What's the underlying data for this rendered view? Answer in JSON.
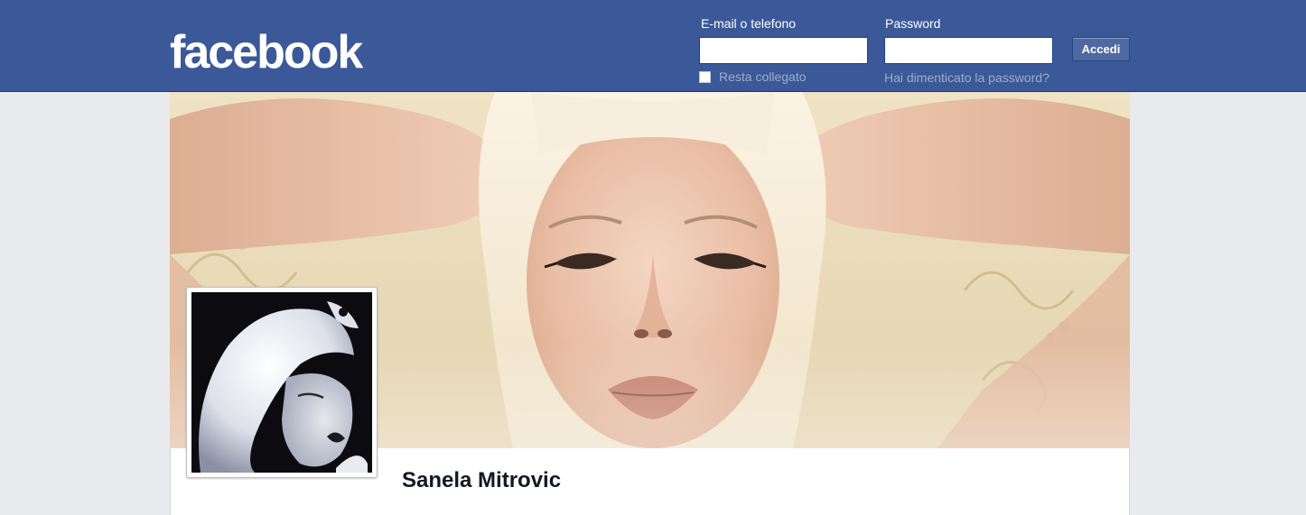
{
  "header": {
    "logo_text": "facebook",
    "email_label": "E-mail o telefono",
    "email_value": "",
    "password_label": "Password",
    "password_value": "",
    "login_button": "Accedi",
    "remember_label": "Resta collegato",
    "remember_checked": false,
    "forgot_link": "Hai dimenticato la password?"
  },
  "profile": {
    "name": "Sanela Mitrovic"
  },
  "colors": {
    "brand": "#3b5998",
    "page_bg": "#e9eaed",
    "muted_link": "#9daccb"
  }
}
